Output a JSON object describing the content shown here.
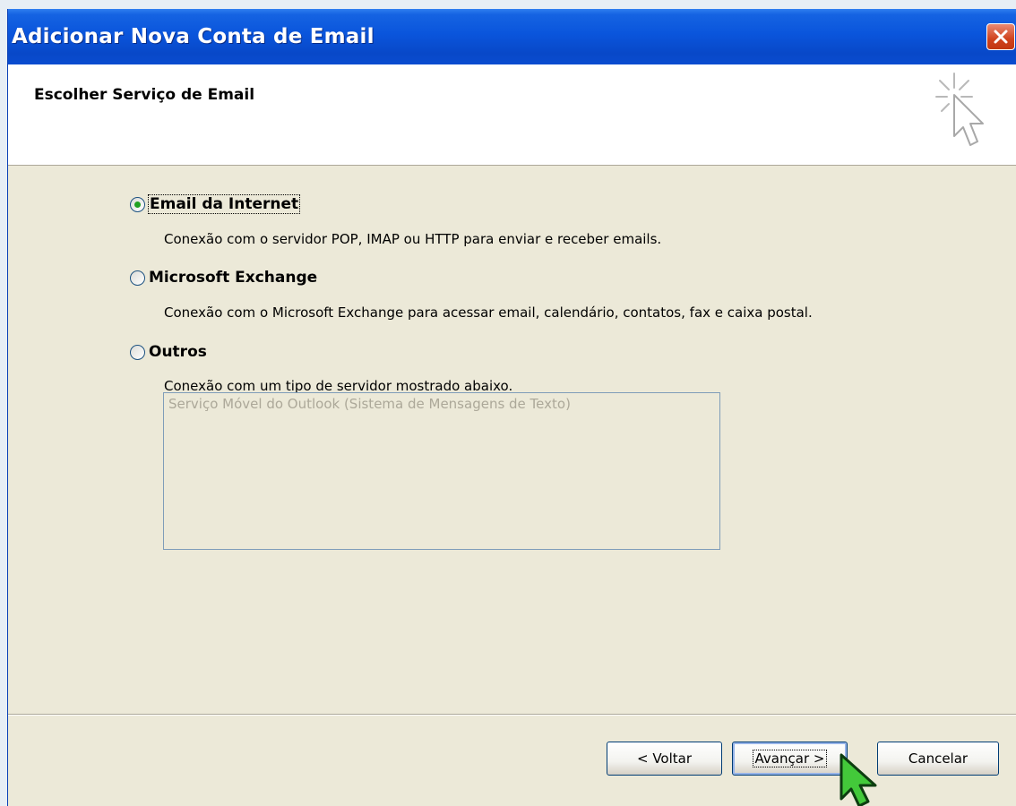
{
  "window": {
    "title": "Adicionar Nova Conta de Email"
  },
  "header": {
    "heading": "Escolher Serviço de Email"
  },
  "options": [
    {
      "label": "Email da Internet",
      "description": "Conexão com o servidor POP, IMAP ou HTTP para enviar e receber emails.",
      "checked": true
    },
    {
      "label": "Microsoft Exchange",
      "description": "Conexão com o Microsoft Exchange para acessar email, calendário, contatos, fax e caixa postal.",
      "checked": false
    },
    {
      "label": "Outros",
      "description": "Conexão com um tipo de servidor mostrado abaixo.",
      "checked": false
    }
  ],
  "server_list": {
    "items": [
      "Serviço Móvel do Outlook (Sistema de Mensagens de Texto)"
    ]
  },
  "buttons": {
    "back": "< Voltar",
    "next": "Avançar >",
    "cancel": "Cancelar"
  },
  "colors": {
    "titlebar": "#0a55dc",
    "dialog_bg": "#ece9d8",
    "radio_dot": "#21a121",
    "cursor_fill": "#43c93a"
  },
  "icons": {
    "close": "close-icon",
    "wizard": "cursor-sparkle-icon",
    "pointer": "mouse-pointer-icon"
  }
}
